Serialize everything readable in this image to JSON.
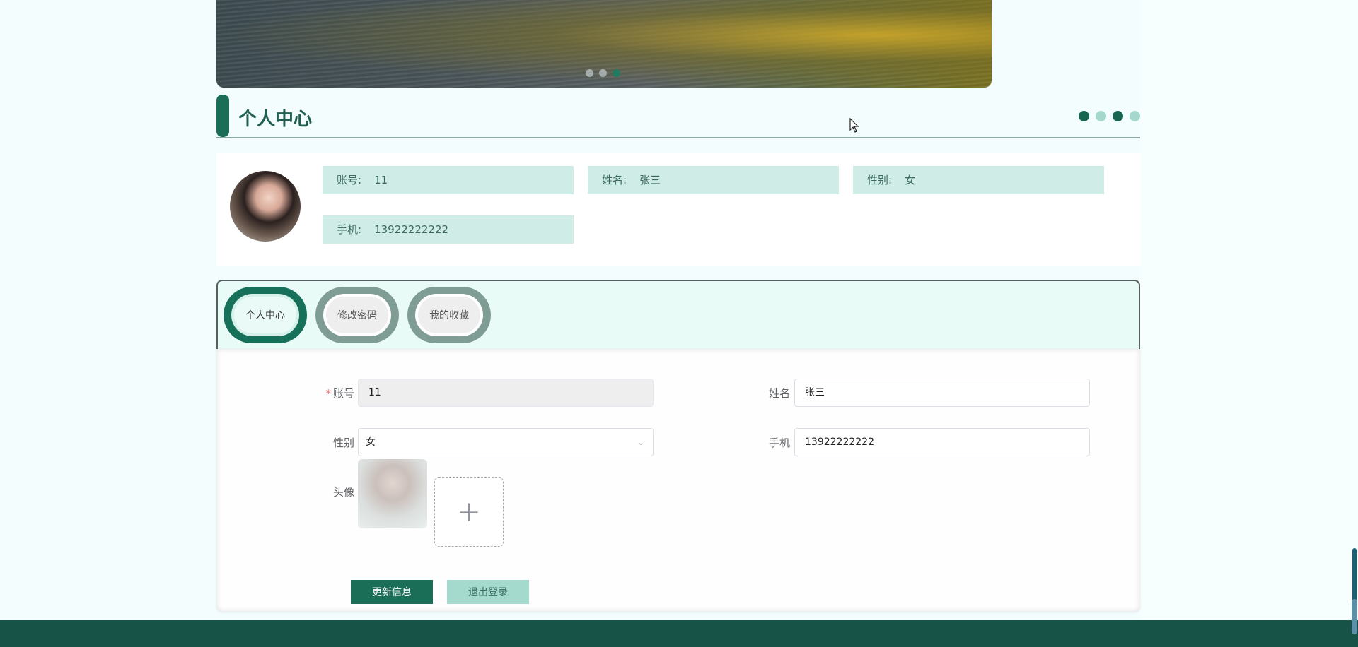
{
  "banner": {
    "dots": 3,
    "active_dot": 3
  },
  "section": {
    "title": "个人中心"
  },
  "profile": {
    "account_label": "账号:",
    "account_value": "11",
    "name_label": "姓名:",
    "name_value": "张三",
    "gender_label": "性别:",
    "gender_value": "女",
    "phone_label": "手机:",
    "phone_value": "13922222222"
  },
  "tabs": [
    {
      "label": "个人中心",
      "active": true
    },
    {
      "label": "修改密码",
      "active": false
    },
    {
      "label": "我的收藏",
      "active": false
    }
  ],
  "form": {
    "account_label": "账号",
    "account_value": "11",
    "required_mark": "*",
    "name_label": "姓名",
    "name_value": "张三",
    "gender_label": "性别",
    "gender_value": "女",
    "phone_label": "手机",
    "phone_value": "13922222222",
    "avatar_label": "头像",
    "upload_symbol": "+"
  },
  "buttons": {
    "update": "更新信息",
    "logout": "退出登录"
  },
  "colors": {
    "primary": "#1a6e57",
    "accent_light": "#a3dacd",
    "chip_bg": "#d0ece6",
    "footer": "#175346"
  }
}
